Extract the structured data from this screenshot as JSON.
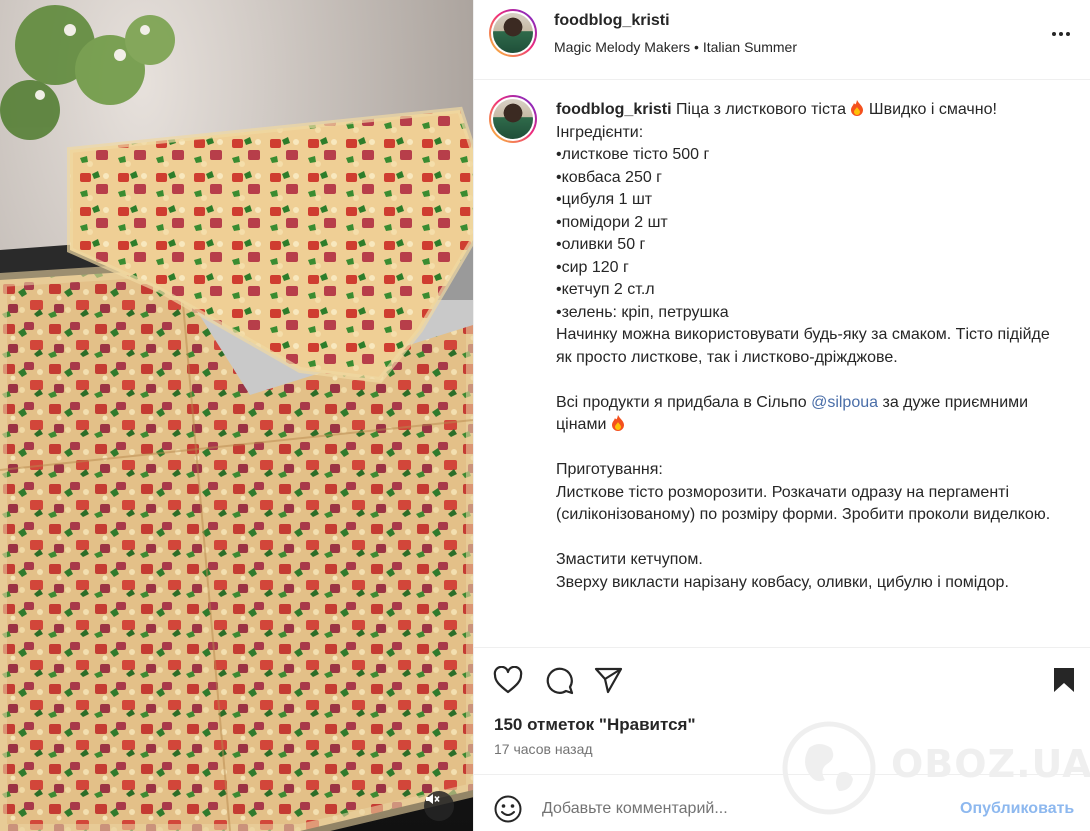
{
  "post": {
    "username": "foodblog_kristi",
    "audio_artist": "Magic Melody Makers",
    "separator": "•",
    "audio_track": "Italian Summer"
  },
  "caption": {
    "title": "Піца з листкового тіста",
    "title_tail": "Швидко і смачно!",
    "ingredients_heading": "Інгредієнти:",
    "ingredients": [
      "•листкове тісто 500 г",
      "•ковбаса 250 г",
      "•цибуля 1 шт",
      "•помідори 2 шт",
      "•оливки 50 г",
      "•сир 120 г",
      "•кетчуп 2 ст.л",
      "•зелень: кріп, петрушка"
    ],
    "note": "Начинку можна використовувати будь-яку за смаком. Тісто підійде як просто листкове, так і листково-дріжджове.",
    "shop_text": "Всі продукти я придбала в Сільпо",
    "mention": "@silpoua",
    "shop_text_tail": "за дуже приємними цінами",
    "method_heading": "Приготування:",
    "step1": "Листкове тісто розморозити. Розкачати одразу на пергаменті (силіконізованому) по розміру форми. Зробити проколи виделкою.",
    "step2a": "Змастити кетчупом.",
    "step2b": "Зверху викласти нарізану ковбасу, оливки, цибулю і помідор."
  },
  "footer": {
    "likes": "150 отметок \"Нравится\"",
    "time": "17 часов назад"
  },
  "comment": {
    "placeholder": "Добавьте комментарий...",
    "post_label": "Опубликовать"
  },
  "watermark": {
    "text": "OBOZ.UA"
  },
  "icons": {
    "like": "heart-icon",
    "comment": "comment-icon",
    "share": "send-icon",
    "save": "bookmark-icon",
    "more": "more-dots-icon",
    "emoji": "emoji-icon",
    "mute": "muted-speaker-icon"
  },
  "colors": {
    "link": "#4a6ea8",
    "post_button": "#8db8ef",
    "secondary_text": "#737373",
    "story_ring_start": "#f9ce34",
    "story_ring_end": "#6228d7"
  }
}
